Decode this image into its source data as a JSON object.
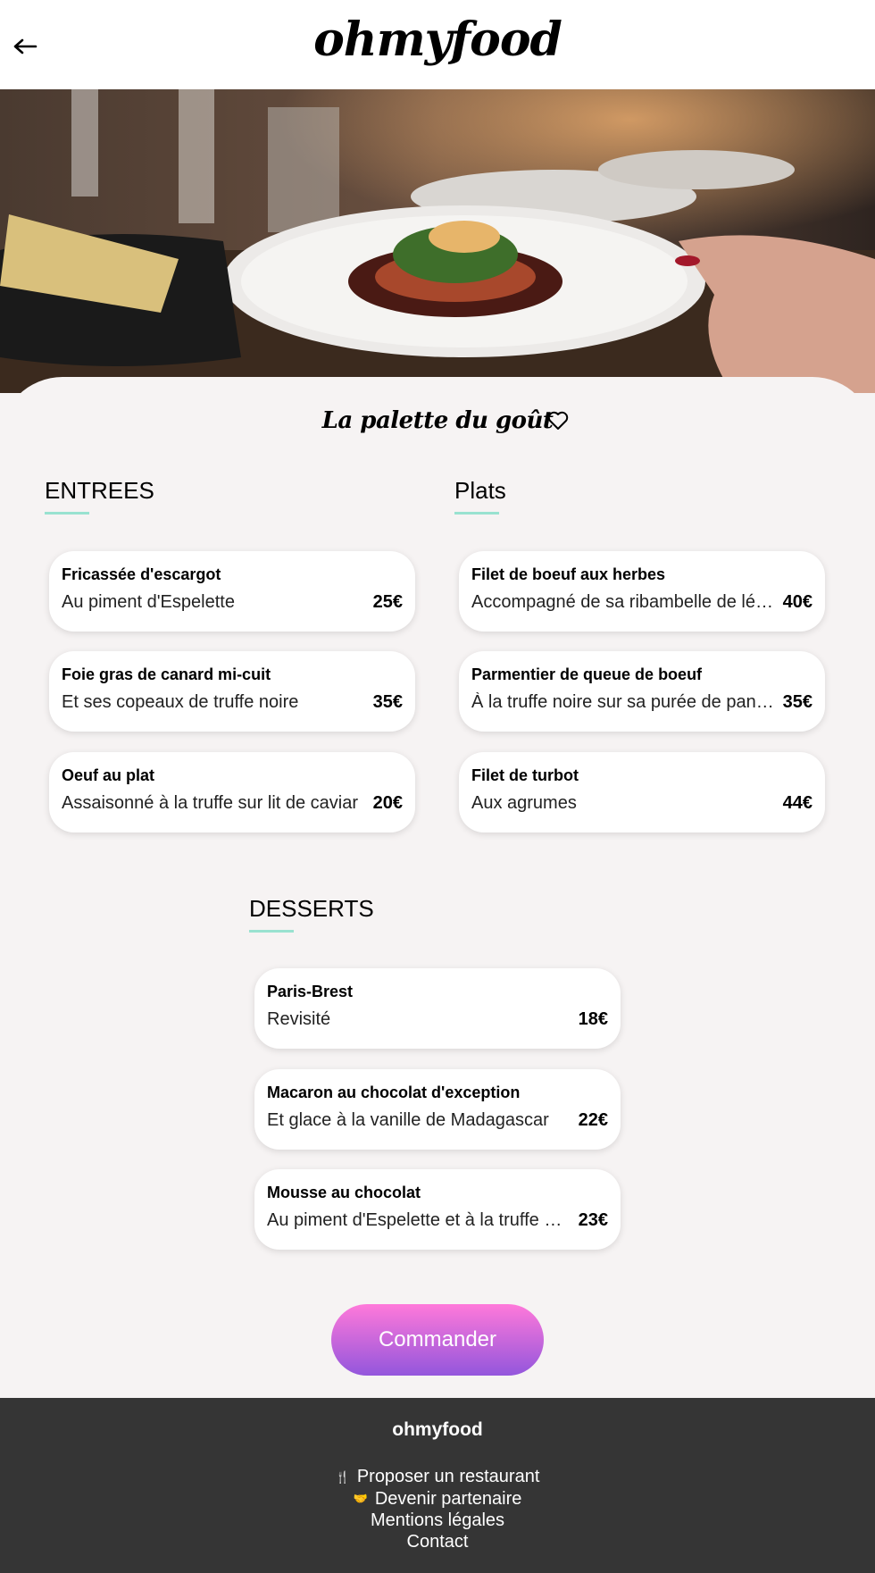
{
  "header": {
    "logo": "ohmyfood",
    "back_icon": "arrow-left-icon"
  },
  "restaurant": {
    "name": "La palette du goût",
    "favorite_icon": "heart-icon"
  },
  "sections": [
    {
      "title": "ENTREES",
      "dishes": [
        {
          "name": "Fricassée d'escargot",
          "description": "Au piment d'Espelette",
          "price": "25€"
        },
        {
          "name": "Foie gras de canard mi-cuit",
          "description": "Et ses copeaux de truffe noire",
          "price": "35€"
        },
        {
          "name": "Oeuf au plat",
          "description": "Assaisonné à la truffe sur lit de caviar",
          "price": "20€"
        }
      ]
    },
    {
      "title": "Plats",
      "dishes": [
        {
          "name": "Filet de boeuf aux herbes",
          "description": "Accompagné de sa ribambelle de lég…",
          "price": "40€"
        },
        {
          "name": "Parmentier de queue de boeuf",
          "description": "À la truffe noire sur sa purée de panais",
          "price": "35€"
        },
        {
          "name": "Filet de turbot",
          "description": "Aux agrumes",
          "price": "44€"
        }
      ]
    },
    {
      "title": "DESSERTS",
      "dishes": [
        {
          "name": "Paris-Brest",
          "description": "Revisité",
          "price": "18€"
        },
        {
          "name": "Macaron au chocolat d'exception",
          "description": "Et glace à la vanille de Madagascar",
          "price": "22€"
        },
        {
          "name": "Mousse au chocolat",
          "description": "Au piment d'Espelette et à la truffe n…",
          "price": "23€"
        }
      ]
    }
  ],
  "order_button": "Commander",
  "footer": {
    "logo": "ohmyfood",
    "links": [
      {
        "label": "Proposer un restaurant",
        "icon": "utensils-icon"
      },
      {
        "label": "Devenir partenaire",
        "icon": "handshake-icon"
      },
      {
        "label": "Mentions légales"
      },
      {
        "label": "Contact"
      }
    ]
  },
  "colors": {
    "accent_underline": "#99e2d0",
    "button_top": "#ff79da",
    "button_bottom": "#9356dc",
    "footer_bg": "#353535"
  }
}
